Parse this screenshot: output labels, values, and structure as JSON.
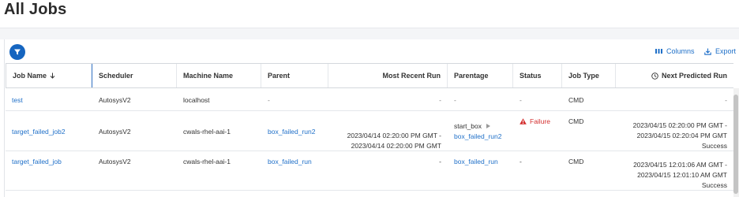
{
  "page": {
    "title": "All Jobs"
  },
  "toolbar": {
    "columns_label": "Columns",
    "export_label": "Export"
  },
  "table": {
    "headers": [
      "Job Name",
      "Scheduler",
      "Machine Name",
      "Parent",
      "Most Recent Run",
      "Parentage",
      "Status",
      "Job Type",
      "Next Predicted Run"
    ],
    "rows": [
      {
        "job_name": "test",
        "scheduler": "AutosysV2",
        "machine": "localhost",
        "parent": "-",
        "recent_run": [
          "-"
        ],
        "parentage_top": "-",
        "parentage_bottom": "",
        "status": "-",
        "job_type": "CMD",
        "next_run": [
          "-"
        ]
      },
      {
        "job_name": "target_failed_job2",
        "scheduler": "AutosysV2",
        "machine": "cwals-rhel-aai-1",
        "parent": "box_failed_run2",
        "recent_run": [
          "2023/04/14 02:20:00 PM GMT -",
          "2023/04/14 02:20:00 PM GMT"
        ],
        "parentage_top": "start_box",
        "parentage_bottom": "box_failed_run2",
        "status": "Failure",
        "job_type": "CMD",
        "next_run": [
          "2023/04/15 02:20:00 PM GMT -",
          "2023/04/15 02:20:04 PM GMT",
          "Success"
        ]
      },
      {
        "job_name": "target_failed_job",
        "scheduler": "AutosysV2",
        "machine": "cwals-rhel-aai-1",
        "parent": "box_failed_run",
        "recent_run": [
          "-"
        ],
        "parentage_top": "box_failed_run",
        "parentage_bottom": "",
        "status": "-",
        "job_type": "CMD",
        "next_run": [
          "2023/04/15 12:01:06 AM GMT -",
          "2023/04/15 12:01:10 AM GMT",
          "Success"
        ]
      }
    ]
  },
  "colors": {
    "accent": "#1565c0",
    "link": "#1e6fc8",
    "failure": "#d32f2f"
  },
  "icons": {
    "filter": "filter-icon",
    "columns": "columns-icon",
    "export": "export-icon",
    "sort": "arrow-down-icon",
    "clock": "clock-icon",
    "warning": "warning-icon",
    "play": "play-icon"
  }
}
